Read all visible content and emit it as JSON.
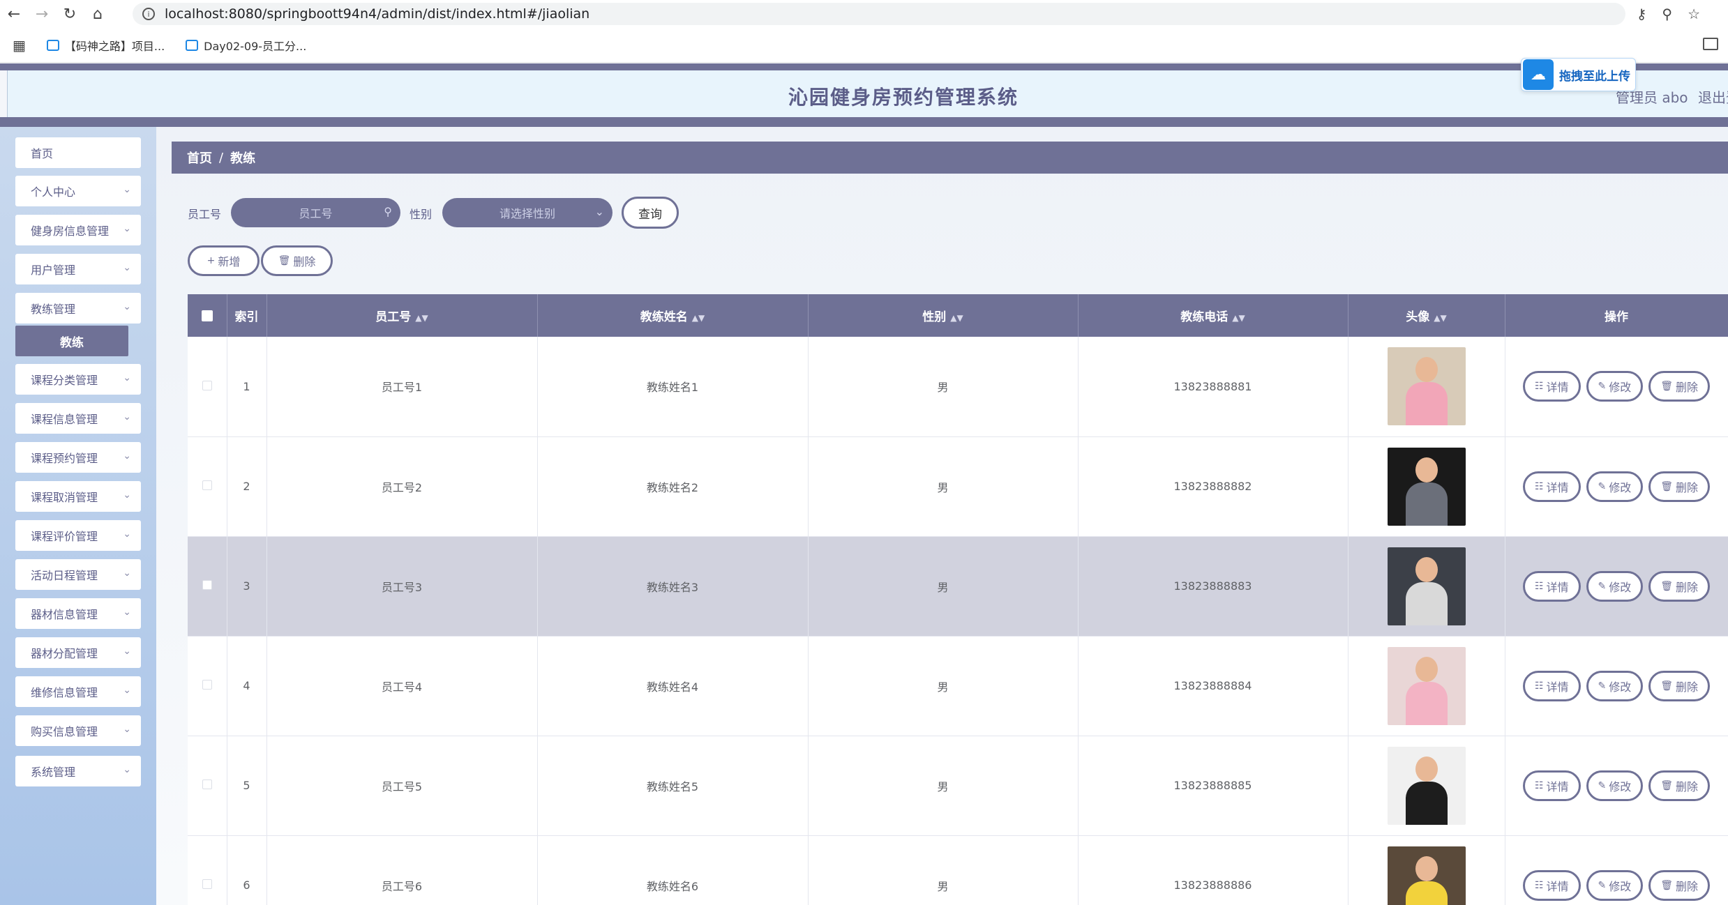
{
  "browser": {
    "url": "localhost:8080/springboott94n4/admin/dist/index.html#/jiaolian",
    "bookmarks": [
      "【码神之路】项目...",
      "Day02-09-员工分..."
    ]
  },
  "header": {
    "title": "沁园健身房预约管理系统",
    "admin": "管理员 abo",
    "logout": "退出登录",
    "upload_badge": "拖拽至此上传"
  },
  "sidebar": {
    "items": [
      {
        "label": "首页",
        "has_chevron": false
      },
      {
        "label": "个人中心",
        "has_chevron": true
      },
      {
        "label": "健身房信息管理",
        "has_chevron": true
      },
      {
        "label": "用户管理",
        "has_chevron": true
      },
      {
        "label": "教练管理",
        "has_chevron": true
      },
      {
        "label": "课程分类管理",
        "has_chevron": true
      },
      {
        "label": "课程信息管理",
        "has_chevron": true
      },
      {
        "label": "课程预约管理",
        "has_chevron": true
      },
      {
        "label": "课程取消管理",
        "has_chevron": true
      },
      {
        "label": "课程评价管理",
        "has_chevron": true
      },
      {
        "label": "活动日程管理",
        "has_chevron": true
      },
      {
        "label": "器材信息管理",
        "has_chevron": true
      },
      {
        "label": "器材分配管理",
        "has_chevron": true
      },
      {
        "label": "维修信息管理",
        "has_chevron": true
      },
      {
        "label": "购买信息管理",
        "has_chevron": true
      },
      {
        "label": "系统管理",
        "has_chevron": true
      }
    ],
    "active_sub": "教练"
  },
  "breadcrumb": {
    "home": "首页",
    "sep": "/",
    "current": "教练"
  },
  "filters": {
    "employee_label": "员工号",
    "employee_placeholder": "员工号",
    "gender_label": "性别",
    "gender_placeholder": "请选择性别",
    "query": "查询"
  },
  "actions": {
    "add": "新增",
    "delete": "删除"
  },
  "table": {
    "headers": [
      "索引",
      "员工号",
      "教练姓名",
      "性别",
      "教练电话",
      "头像",
      "操作"
    ],
    "rows": [
      {
        "index": "1",
        "emp_no": "员工号1",
        "name": "教练姓名1",
        "gender": "男",
        "phone": "13823888881"
      },
      {
        "index": "2",
        "emp_no": "员工号2",
        "name": "教练姓名2",
        "gender": "男",
        "phone": "13823888882"
      },
      {
        "index": "3",
        "emp_no": "员工号3",
        "name": "教练姓名3",
        "gender": "男",
        "phone": "13823888883"
      },
      {
        "index": "4",
        "emp_no": "员工号4",
        "name": "教练姓名4",
        "gender": "男",
        "phone": "13823888884"
      },
      {
        "index": "5",
        "emp_no": "员工号5",
        "name": "教练姓名5",
        "gender": "男",
        "phone": "13823888885"
      },
      {
        "index": "6",
        "emp_no": "员工号6",
        "name": "教练姓名6",
        "gender": "男",
        "phone": "13823888886"
      }
    ],
    "ops": {
      "detail": "详情",
      "edit": "修改",
      "delete": "删除"
    }
  },
  "colors": {
    "accent": "#6f7196",
    "header_bg": "#e8f4fc",
    "row_highlight": "#d1d2de"
  }
}
